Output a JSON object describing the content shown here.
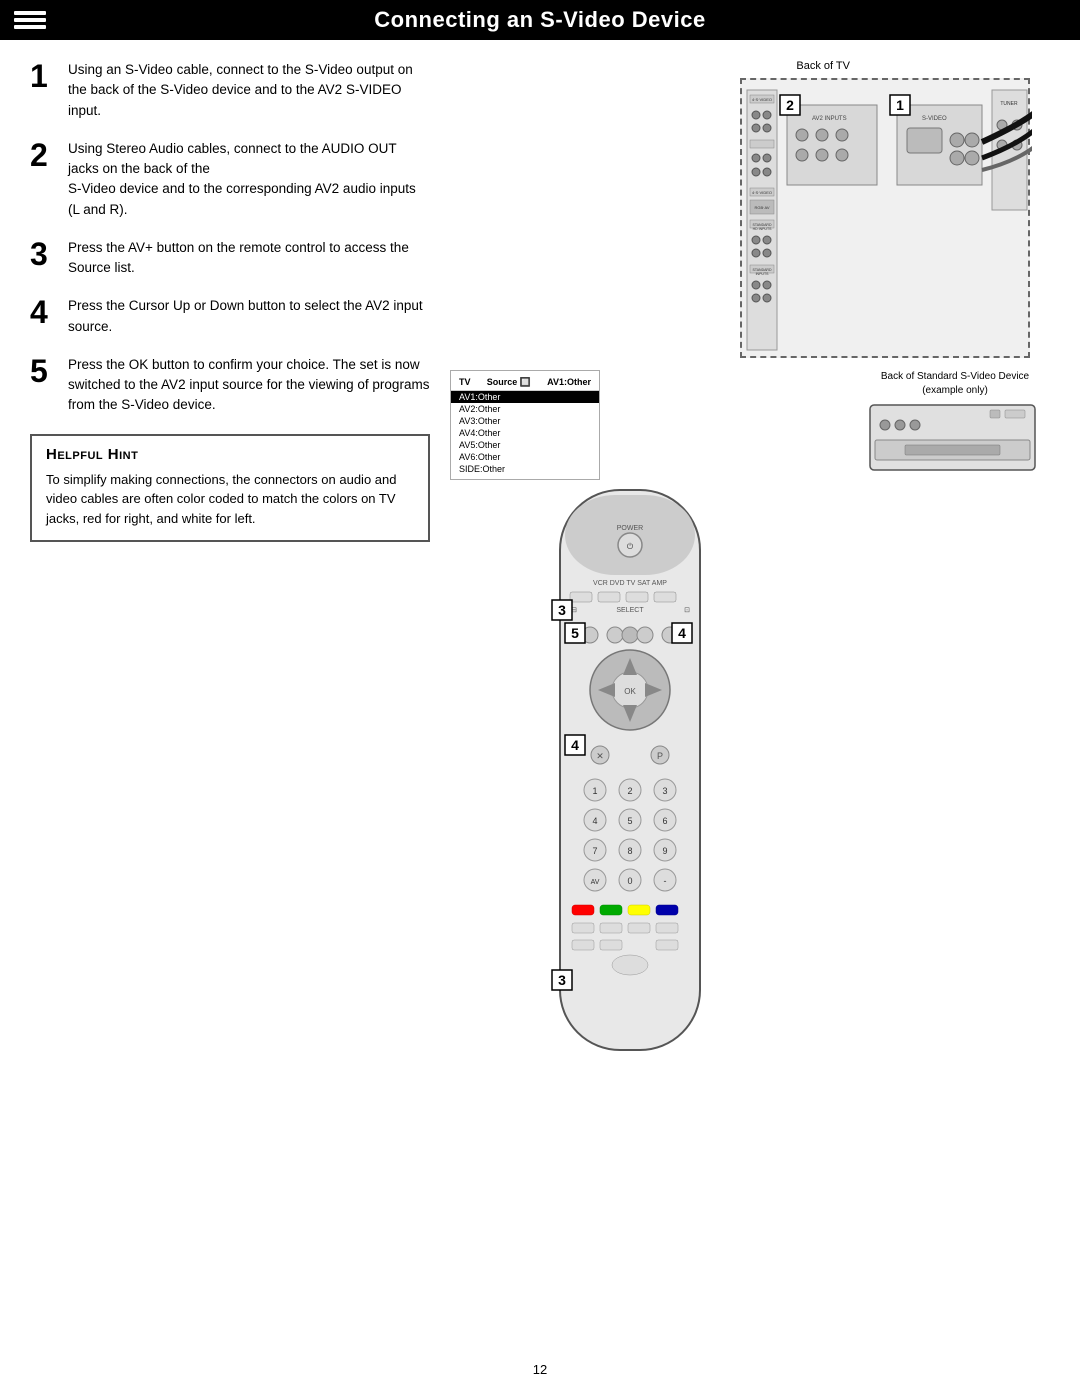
{
  "header": {
    "title": "Connecting an S-Video Device",
    "icon_label": "cable-icon"
  },
  "steps": [
    {
      "number": "1",
      "text": "Using an S-Video cable, connect to the S-Video output on the back of the S-Video device and to the AV2 S-VIDEO input."
    },
    {
      "number": "2",
      "text": "Using Stereo Audio cables, connect to the AUDIO OUT jacks on the back of the\nS-Video device and to the corresponding AV2 audio inputs (L and R)."
    },
    {
      "number": "3",
      "text": "Press the AV+ button on the remote control to access the Source list."
    },
    {
      "number": "4",
      "text": "Press the Cursor Up or Down button to select the AV2 input source."
    },
    {
      "number": "5",
      "text": "Press the OK button to confirm your choice. The set is now switched to the AV2 input source for the viewing of programs from the S-Video device."
    }
  ],
  "hint": {
    "title": "Helpful Hint",
    "text": "To simplify making connections, the connectors on audio and video cables are often color coded to match the colors on TV jacks, red for right, and white for left."
  },
  "diagram": {
    "tv_label": "Back of TV",
    "svideo_device_label": "Back of Standard S-Video Device\n(example only)"
  },
  "source_menu": {
    "header_left": "TV",
    "header_source": "Source",
    "header_item": "AV1:Other",
    "items": [
      "AV1:Other",
      "AV2:Other",
      "AV3:Other",
      "AV4:Other",
      "AV5:Other",
      "AV6:Other",
      "SIDE:Other"
    ],
    "selected": "AV1:Other"
  },
  "page_number": "12"
}
